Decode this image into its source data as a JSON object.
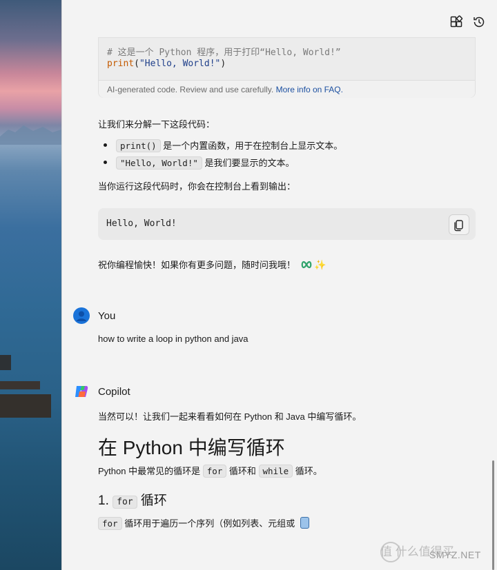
{
  "code_block": {
    "comment": "# 这是一个 Python 程序，用于打印“Hello, World!”",
    "fn": "print",
    "open": "(",
    "arg": "\"Hello, World!\"",
    "close": ")",
    "footer_note": "AI-generated code. Review and use carefully.",
    "footer_link": "More info on FAQ."
  },
  "explain": {
    "intro": "让我们来分解一下这段代码：",
    "bullets": [
      {
        "code": "print()",
        "text": " 是一个内置函数，用于在控制台上显示文本。"
      },
      {
        "code": "\"Hello, World!\"",
        "text": " 是我们要显示的文本。"
      }
    ],
    "run_text": "当你运行这段代码时，你会在控制台上看到输出：",
    "output": "Hello, World!",
    "closing": "祝你编程愉快！如果你有更多问题，随时问我哦！"
  },
  "user_msg": {
    "sender": "You",
    "text": "how to write a loop in python and java"
  },
  "copilot_msg": {
    "sender": "Copilot",
    "intro": "当然可以！让我们一起来看看如何在 Python 和 Java 中编写循环。",
    "heading": "在 Python 中编写循环",
    "line1_a": "Python 中最常见的循环是 ",
    "line1_code1": "for",
    "line1_b": " 循环和 ",
    "line1_code2": "while",
    "line1_c": " 循环。",
    "sub_num": "1. ",
    "sub_code": "for",
    "sub_text": " 循环",
    "line2_code": "for",
    "line2_text": " 循环用于遍历一个序列（例如列表、元组或"
  },
  "watermark": {
    "text": "值 什么值得买",
    "brand": "SMYZ.NET"
  },
  "icons": [
    "apps-icon",
    "history-icon",
    "copy-icon",
    "user-avatar",
    "copilot-logo",
    "sparkle-emoji",
    "infinity-emoji"
  ]
}
